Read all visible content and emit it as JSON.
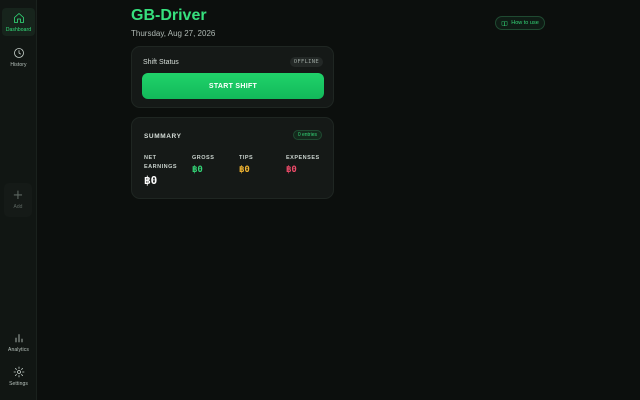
{
  "sidebar": {
    "items": [
      {
        "label": "Dashboard",
        "icon": "home-icon",
        "active": true
      },
      {
        "label": "History",
        "icon": "clock-icon",
        "active": false
      },
      {
        "label": "Add",
        "icon": "plus-icon",
        "active": false
      },
      {
        "label": "Analytics",
        "icon": "bar-chart-icon",
        "active": false
      },
      {
        "label": "Settings",
        "icon": "gear-icon",
        "active": false
      }
    ]
  },
  "header": {
    "title": "GB-Driver",
    "date": "Thursday, Aug 27, 2026",
    "howto_label": "How to use"
  },
  "shift": {
    "label": "Shift Status",
    "status": "OFFLINE",
    "button_label": "START SHIFT"
  },
  "summary": {
    "title": "SUMMARY",
    "period": "0 entries",
    "metrics": [
      {
        "label": "NET EARNINGS",
        "value": "฿0",
        "color": "#ffffff"
      },
      {
        "label": "GROSS",
        "value": "฿0",
        "color": "#34d577"
      },
      {
        "label": "TIPS",
        "value": "฿0",
        "color": "#f2b531"
      },
      {
        "label": "EXPENSES",
        "value": "฿0",
        "color": "#ef4b6a"
      }
    ]
  },
  "colors": {
    "accent": "#36e07d",
    "background": "#0c0f0d",
    "card": "#151917"
  }
}
